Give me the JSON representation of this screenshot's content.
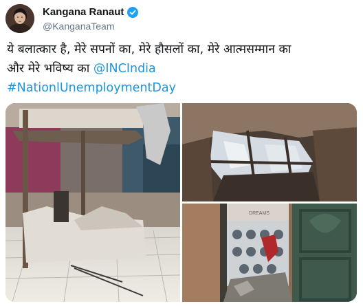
{
  "author": {
    "name": "Kangana Ranaut",
    "handle": "@KanganaTeam",
    "verified_icon": "verified-badge-icon",
    "avatar_icon": "avatar-photo"
  },
  "tweet": {
    "line1": "ये बलात्कार है, मेरे सपनों का, मेरे हौसलों का, मेरे आत्मसम्मान का",
    "line2_prefix": "और मेरे भविष्य का ",
    "mention": "@INCIndia",
    "hashtag": "#NationlUnemploymentDay"
  },
  "media": {
    "photos": [
      "demolished-room-photo",
      "broken-ceiling-photo",
      "demolished-bathroom-photo"
    ],
    "photo3_sign_text": "DREAMS"
  },
  "colors": {
    "link": "#1b95e0",
    "handle_gray": "#657786",
    "verified_blue": "#1da1f2"
  }
}
